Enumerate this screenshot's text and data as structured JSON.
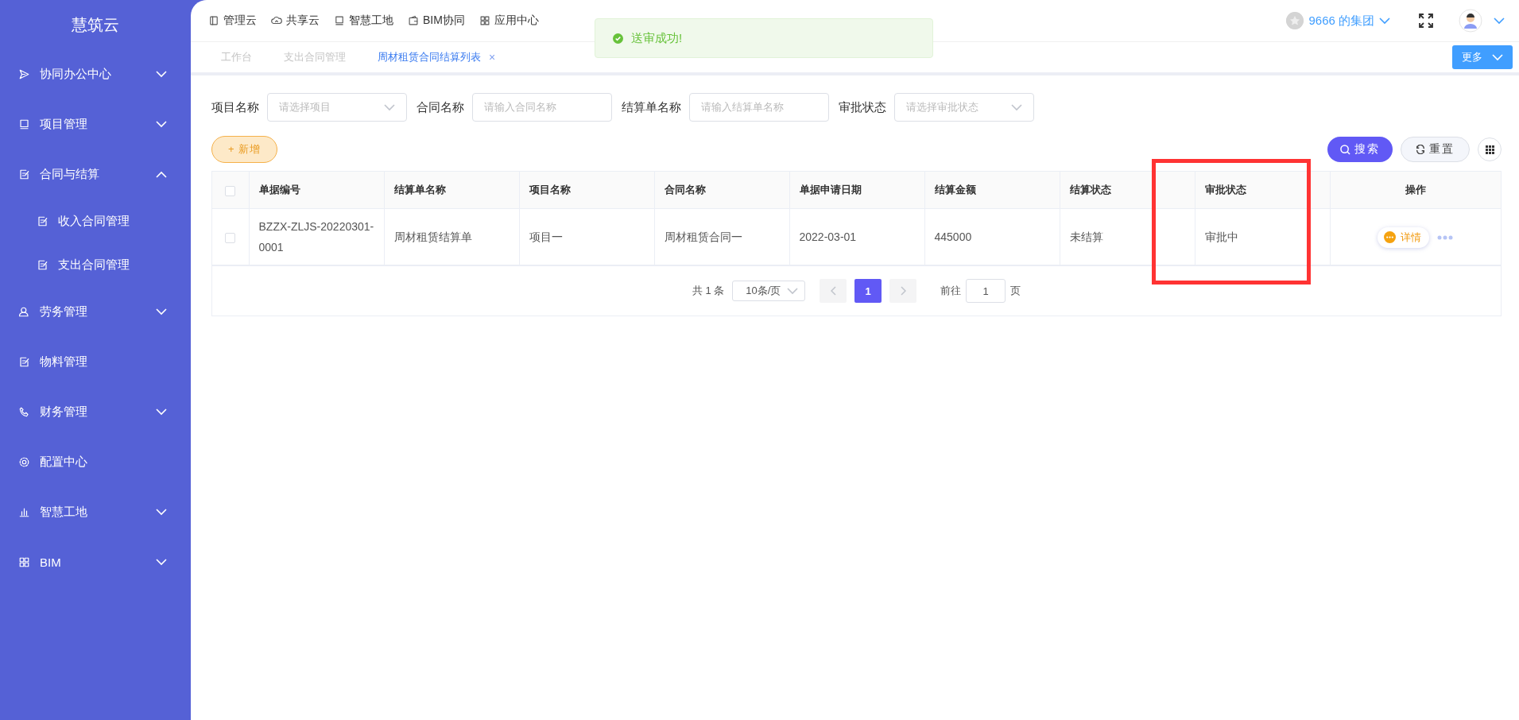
{
  "sidebar": {
    "title": "慧筑云",
    "items": [
      {
        "label": "协同办公中心",
        "expanded": false
      },
      {
        "label": "项目管理",
        "expanded": false
      },
      {
        "label": "合同与结算",
        "expanded": true,
        "children": [
          {
            "label": "收入合同管理"
          },
          {
            "label": "支出合同管理"
          }
        ]
      },
      {
        "label": "劳务管理",
        "expanded": false
      },
      {
        "label": "物料管理"
      },
      {
        "label": "财务管理",
        "expanded": false
      },
      {
        "label": "配置中心"
      },
      {
        "label": "智慧工地",
        "expanded": false
      },
      {
        "label": "BIM",
        "expanded": false
      }
    ]
  },
  "top_nav": {
    "items": [
      {
        "label": "管理云"
      },
      {
        "label": "共享云"
      },
      {
        "label": "智慧工地"
      },
      {
        "label": "BIM协同"
      },
      {
        "label": "应用中心"
      }
    ],
    "organization": "9666 的集团"
  },
  "toast": {
    "message": "送审成功!"
  },
  "tabs": {
    "items": [
      {
        "label": "工作台",
        "selected": false
      },
      {
        "label": "支出合同管理",
        "selected": false
      },
      {
        "label": "周材租赁合同结算列表",
        "selected": true,
        "close": "×"
      }
    ],
    "more_button": "更多"
  },
  "filters": [
    {
      "kind": "select",
      "label": "项目名称",
      "placeholder": "请选择项目"
    },
    {
      "kind": "input",
      "label": "合同名称",
      "placeholder": "请输入合同名称"
    },
    {
      "kind": "input",
      "label": "结算单名称",
      "placeholder": "请输入结算单名称"
    },
    {
      "kind": "select",
      "label": "审批状态",
      "placeholder": "请选择审批状态"
    }
  ],
  "toolbar": {
    "add_button": "+ 新增",
    "search_button": "搜索",
    "reset_button": "重置"
  },
  "table": {
    "header_checked": false,
    "columns": [
      {
        "label": "单据编号",
        "highlighted": false
      },
      {
        "label": "结算单名称",
        "highlighted": false
      },
      {
        "label": "项目名称",
        "highlighted": false
      },
      {
        "label": "合同名称",
        "highlighted": false
      },
      {
        "label": "单据申请日期",
        "highlighted": false
      },
      {
        "label": "结算金额",
        "highlighted": false
      },
      {
        "label": "结算状态",
        "highlighted": false
      },
      {
        "label": "审批状态",
        "highlighted": true
      },
      {
        "label": "操作",
        "highlighted": false
      }
    ],
    "rows": [
      {
        "checked": false,
        "cells": [
          "BZZX-ZLJS-20220301-0001",
          "周材租赁结算单",
          "项目一",
          "周材租赁合同一",
          "2022-03-01",
          "445000",
          "未结算",
          "审批中"
        ],
        "action": "详情"
      }
    ]
  },
  "pagination": {
    "total": "共 1 条",
    "page_size": "10条/页",
    "pages": [
      {
        "label": "1",
        "selected": true
      }
    ],
    "goto_label": "前往",
    "goto_value": "1",
    "goto_suffix": "页"
  }
}
